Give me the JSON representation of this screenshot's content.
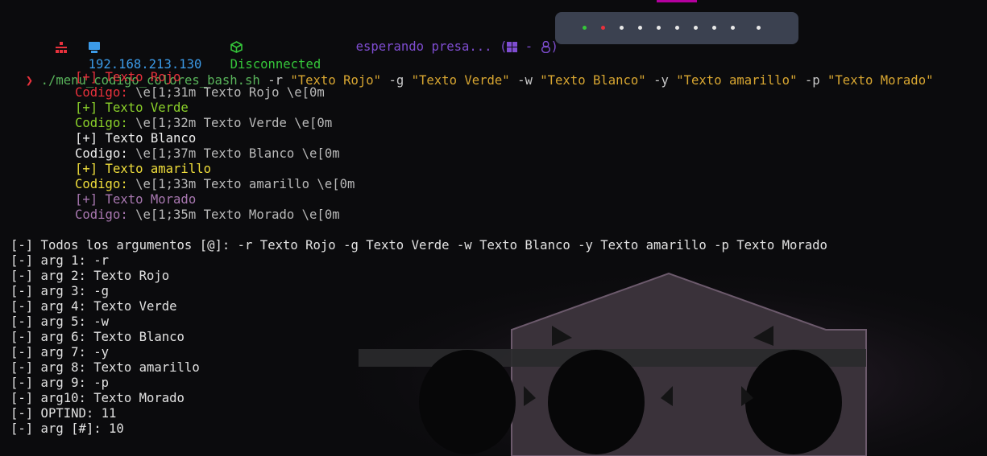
{
  "topbar": {
    "ip": "192.168.213.130",
    "vpn_status": "Disconnected",
    "target_text": "esperando presa... (",
    "target_sep": " - ",
    "target_close": ")",
    "workspace_dots": 10,
    "colors": {
      "ip": "#3c9be8",
      "vpn": "#35c63a",
      "target": "#7f4dd1",
      "pill_bg": "#3b4150",
      "accent": "#b4009e"
    },
    "icons": [
      "red-network-icon",
      "monitor-icon",
      "cube-icon",
      "windows-icon",
      "linux-tux-icon"
    ]
  },
  "command": {
    "prompt": "❯",
    "script": "./menu_codigo_colores_bash.sh",
    "args": [
      {
        "flag": "-r",
        "value": "\"Texto Rojo\""
      },
      {
        "flag": "-g",
        "value": "\"Texto Verde\""
      },
      {
        "flag": "-w",
        "value": "\"Texto Blanco\""
      },
      {
        "flag": "-y",
        "value": "\"Texto amarillo\""
      },
      {
        "flag": "-p",
        "value": "\"Texto Morado\""
      }
    ]
  },
  "colored": [
    {
      "title": "[+] Texto Rojo",
      "label": "Codigo:",
      "code": " \\e[1;31m Texto Rojo \\e[0m",
      "color": "red"
    },
    {
      "title": "[+] Texto Verde",
      "label": "Codigo:",
      "code": " \\e[1;32m Texto Verde \\e[0m",
      "color": "green"
    },
    {
      "title": "[+] Texto Blanco",
      "label": "Codigo:",
      "code": " \\e[1;37m Texto Blanco \\e[0m",
      "color": "white"
    },
    {
      "title": "[+] Texto amarillo",
      "label": "Codigo:",
      "code": " \\e[1;33m Texto amarillo \\e[0m",
      "color": "yellow"
    },
    {
      "title": "[+] Texto Morado",
      "label": "Codigo:",
      "code": " \\e[1;35m Texto Morado \\e[0m",
      "color": "purple"
    }
  ],
  "args_output": [
    "[-] Todos los argumentos [@]: -r Texto Rojo -g Texto Verde -w Texto Blanco -y Texto amarillo -p Texto Morado",
    "[-] arg 1: -r",
    "[-] arg 2: Texto Rojo",
    "[-] arg 3: -g",
    "[-] arg 4: Texto Verde",
    "[-] arg 5: -w",
    "[-] arg 6: Texto Blanco",
    "[-] arg 7: -y",
    "[-] arg 8: Texto amarillo",
    "[-] arg 9: -p",
    "[-] arg10: Texto Morado",
    "[-] OPTIND: 11",
    "[-] arg [#]: 10"
  ]
}
